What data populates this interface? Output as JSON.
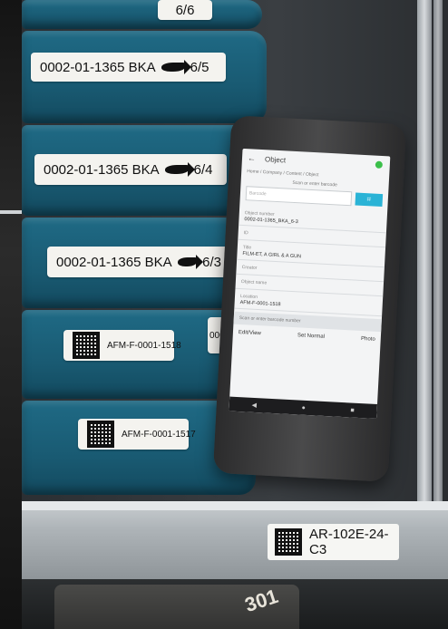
{
  "reels": {
    "top_label": "6/6",
    "labels": [
      {
        "code": "0002-01-1365 BKA",
        "part": "6/5"
      },
      {
        "code": "0002-01-1365 BKA",
        "part": "6/4"
      },
      {
        "code": "0002-01-1365 BKA",
        "part": "6/3"
      }
    ],
    "qr_labels": [
      "AFM-F-0001-1518",
      "AFM-F-0001-1517"
    ],
    "side_label": "0002"
  },
  "shelf_label": "AR-102E-24-C3",
  "bottom_reel_number": "301",
  "phone": {
    "title": "Object",
    "breadcrumb": "Home / Company / Content / Object",
    "scan_hint": "Scan or enter barcode",
    "barcode_placeholder": "Barcode",
    "fields": [
      {
        "label": "Object number",
        "value": "0002-01-1365_BKA_6-3"
      },
      {
        "label": "ID",
        "value": ""
      },
      {
        "label": "Title",
        "value": "FILM-ET, A GIRL & A GUN"
      },
      {
        "label": "Creator",
        "value": ""
      },
      {
        "label": "Object name",
        "value": ""
      },
      {
        "label": "Location",
        "value": "AFM-F-0001-1518"
      }
    ],
    "barcode_row": "Scan or enter barcode number",
    "actions": {
      "left": "Edit/View",
      "middle": "Set Normal",
      "right": "Photo"
    },
    "nav": {
      "back": "◀",
      "home": "●",
      "recent": "■"
    }
  },
  "colors": {
    "reel": "#1f6a85",
    "scan_button": "#2ab3d6",
    "status": "#3bbf4a"
  }
}
